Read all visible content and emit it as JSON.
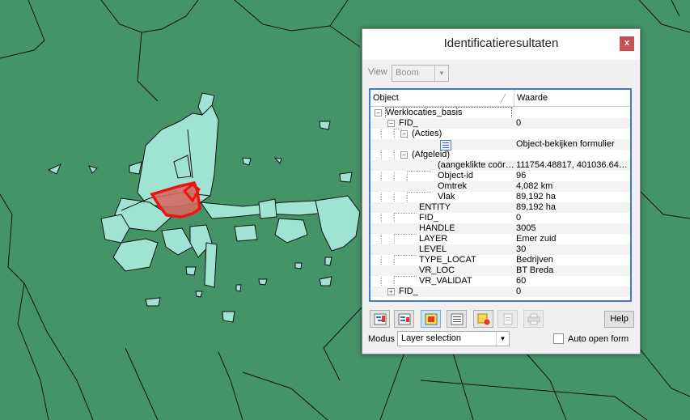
{
  "dialog": {
    "title": "Identificatieresultaten",
    "close_label": "x",
    "view_label": "View",
    "view_value": "Boom",
    "columns": [
      "Object",
      "Waarde"
    ],
    "rows": [
      {
        "label": "Werklocaties_basis",
        "value": ""
      },
      {
        "label": "FID_",
        "value": "0"
      },
      {
        "label": "(Acties)",
        "value": ""
      },
      {
        "label": "",
        "value": "Object-bekijken formulier"
      },
      {
        "label": "(Afgeleid)",
        "value": ""
      },
      {
        "label": "(aangeklikte coör…",
        "value": "111754.48817, 401036.64…"
      },
      {
        "label": "Object-id",
        "value": "96"
      },
      {
        "label": "Omtrek",
        "value": "4,082 km"
      },
      {
        "label": "Vlak",
        "value": "89,192 ha"
      },
      {
        "label": "ENTITY",
        "value": "89,192 ha"
      },
      {
        "label": "FID_",
        "value": "0"
      },
      {
        "label": "HANDLE",
        "value": "3005"
      },
      {
        "label": "LAYER",
        "value": "Emer zuid"
      },
      {
        "label": "LEVEL",
        "value": "30"
      },
      {
        "label": "TYPE_LOCAT",
        "value": "Bedrijven"
      },
      {
        "label": "VR_LOC",
        "value": "BT Breda"
      },
      {
        "label": "VR_VALIDAT",
        "value": "60"
      },
      {
        "label": "FID_",
        "value": "0"
      }
    ],
    "toolbar_icons": [
      "expand-tree-icon",
      "collapse-tree-icon",
      "highlight-feature-icon",
      "form-view-icon",
      "deselect-icon",
      "copy-icon",
      "print-icon"
    ],
    "help_label": "Help",
    "modus_label": "Modus",
    "modus_value": "Layer selection",
    "auto_open_label": "Auto open form"
  },
  "colors": {
    "map_background": "#449468",
    "feature_fill": "#9fe3d3",
    "selected_outline": "#ee1111",
    "selected_fill": "#d36a62"
  }
}
